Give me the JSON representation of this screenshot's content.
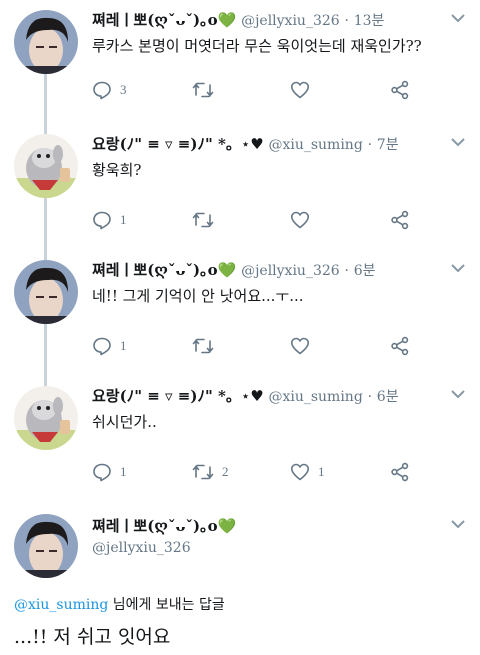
{
  "tweets": [
    {
      "name": "쪄레ㅣ뽀(ღˇᴗˇ)｡o",
      "name_suffix": "💚",
      "handle": "@jellyxiu_326",
      "time": "13분",
      "text": "루카스 본명이 머엿더라 무슨 욱이엇는데 재욱인가??",
      "reply_count": "3",
      "retweet_count": "",
      "like_count": ""
    },
    {
      "name": "요랑(ﾉ\" ≡ ▿ ≡)ﾉ\" *。",
      "name_suffix": "⋆♥",
      "handle": "@xiu_suming",
      "time": "7분",
      "text": "황욱희?",
      "reply_count": "1",
      "retweet_count": "",
      "like_count": ""
    },
    {
      "name": "쪄레ㅣ뽀(ღˇᴗˇ)｡o",
      "name_suffix": "💚",
      "handle": "@jellyxiu_326",
      "time": "6분",
      "text": "네!! 그게 기억이 안 낫어요...ㅜ...",
      "reply_count": "1",
      "retweet_count": "",
      "like_count": ""
    },
    {
      "name": "요랑(ﾉ\" ≡ ▿ ≡)ﾉ\" *。",
      "name_suffix": "⋆♥",
      "handle": "@xiu_suming",
      "time": "6분",
      "text": "쉬시던가..",
      "reply_count": "1",
      "retweet_count": "2",
      "like_count": "1"
    }
  ],
  "main_tweet": {
    "name": "쪄레ㅣ뽀(ღˇᴗˇ)｡o",
    "name_suffix": "💚",
    "handle": "@jellyxiu_326",
    "reply_to_mention": "@xiu_suming",
    "reply_to_suffix": " 님에게 보내는 답글",
    "text": "...!! 저 쉬고 잇어요"
  },
  "icons": {
    "reply": "reply-icon",
    "retweet": "retweet-icon",
    "like": "heart-icon",
    "share": "share-icon",
    "menu": "chevron-down-icon"
  },
  "colors": {
    "icon_gray": "#657786",
    "link_blue": "#1b95e0",
    "thread_line": "#c8d2da",
    "green_heart": "#5eb94c"
  }
}
